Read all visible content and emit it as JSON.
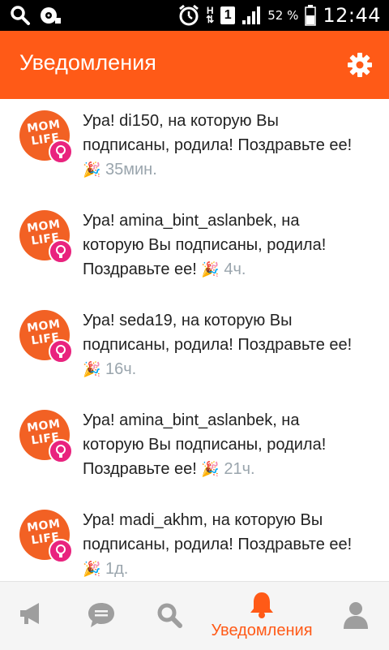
{
  "status_bar": {
    "battery_percent": "52 %",
    "time": "12:44",
    "network_letter": "H",
    "sim_slot": "1"
  },
  "header": {
    "title": "Уведомления"
  },
  "notifications": [
    {
      "text": "Ура! di150, на которую Вы подписаны, родила! Поздравьте ее!",
      "emoji": "🎉",
      "time": "35мин."
    },
    {
      "text": "Ура! amina_bint_aslanbek, на которую Вы подписаны, родила! Поздравьте ее!",
      "emoji": "🎉",
      "time": "4ч."
    },
    {
      "text": "Ура! seda19, на которую Вы подписаны, родила! Поздравьте ее!",
      "emoji": "🎉",
      "time": "16ч."
    },
    {
      "text": "Ура! amina_bint_aslanbek, на которую Вы подписаны, родила! Поздравьте ее!",
      "emoji": "🎉",
      "time": "21ч."
    },
    {
      "text": "Ура! madi_akhm, на которую Вы подписаны, родила! Поздравьте ее!",
      "emoji": "🎉",
      "time": "1д."
    }
  ],
  "avatar": {
    "logo_line1": "MOM",
    "logo_line2": "LIFE"
  },
  "bottom_nav": {
    "active_label": "Уведомления",
    "active_color": "#ff5a17",
    "inactive_color": "#9e9e9e"
  },
  "colors": {
    "brand": "#ff5a17",
    "badge": "#e9237e",
    "timestamp": "#9aa5ad"
  }
}
